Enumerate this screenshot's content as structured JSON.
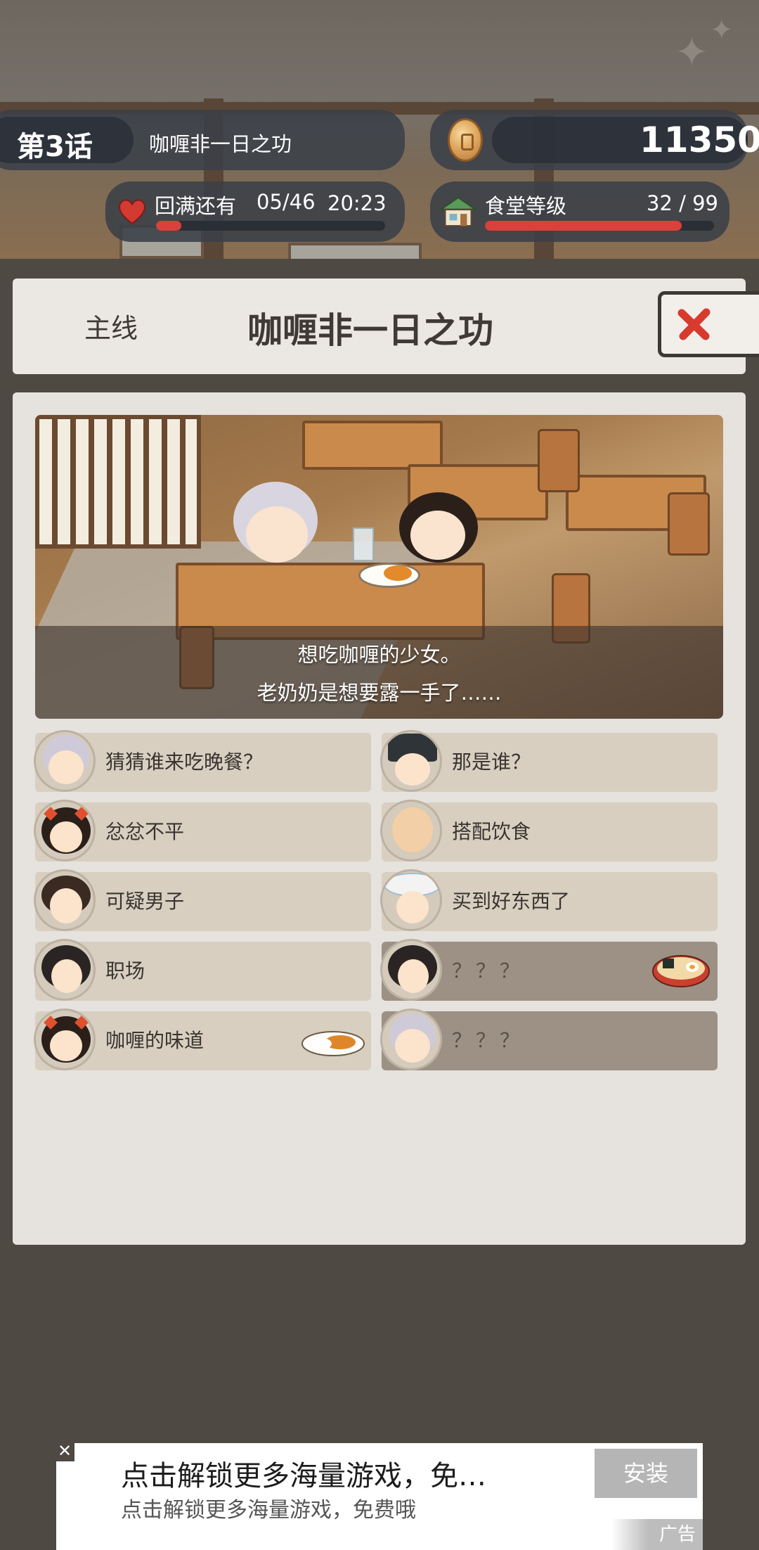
{
  "hud": {
    "episode": "第3话",
    "episode_title": "咖喱非一日之功",
    "coins": "11350",
    "refill_label": "回满还有",
    "stamina": "05/46",
    "refill_timer": "20:23",
    "stamina_fill": 0.11,
    "diner_level_label": "食堂等级",
    "diner_level": "32 / 99",
    "diner_level_fill": 0.86
  },
  "title_panel": {
    "category": "主线",
    "title": "咖喱非一日之功"
  },
  "story": {
    "caption_line1": "想吃咖喱的少女。",
    "caption_line2": "老奶奶是想要露一手了……"
  },
  "chapters": [
    {
      "label": "猜猜谁来吃晚餐？",
      "avatar": "granny",
      "locked": false
    },
    {
      "label": "那是谁？",
      "avatar": "officer",
      "locked": false
    },
    {
      "label": "忿忿不平",
      "avatar": "girl",
      "locked": false
    },
    {
      "label": "搭配饮食",
      "avatar": "monk",
      "locked": false
    },
    {
      "label": "可疑男子",
      "avatar": "man",
      "locked": false
    },
    {
      "label": "买到好东西了",
      "avatar": "lady-hat",
      "locked": false
    },
    {
      "label": "职场",
      "avatar": "woman",
      "locked": false
    },
    {
      "label": "？？？",
      "avatar": "woman",
      "locked": true,
      "food": "ramen"
    },
    {
      "label": "咖喱的味道",
      "avatar": "girl",
      "locked": false,
      "food": "curry"
    },
    {
      "label": "？？？",
      "avatar": "granny",
      "locked": true
    }
  ],
  "ad": {
    "title": "点击解锁更多海量游戏，免…",
    "description": "点击解锁更多海量游戏，免费哦",
    "install_label": "安装",
    "tag": "广告",
    "close_symbol": "✕"
  },
  "colors": {
    "background": "#4e4942",
    "panel": "#e6e2dd",
    "chapter_bg": "#d8cfc1",
    "locked_bg": "#9c9184",
    "bar_red": "#d8423a",
    "close_red": "#d83a2e"
  }
}
